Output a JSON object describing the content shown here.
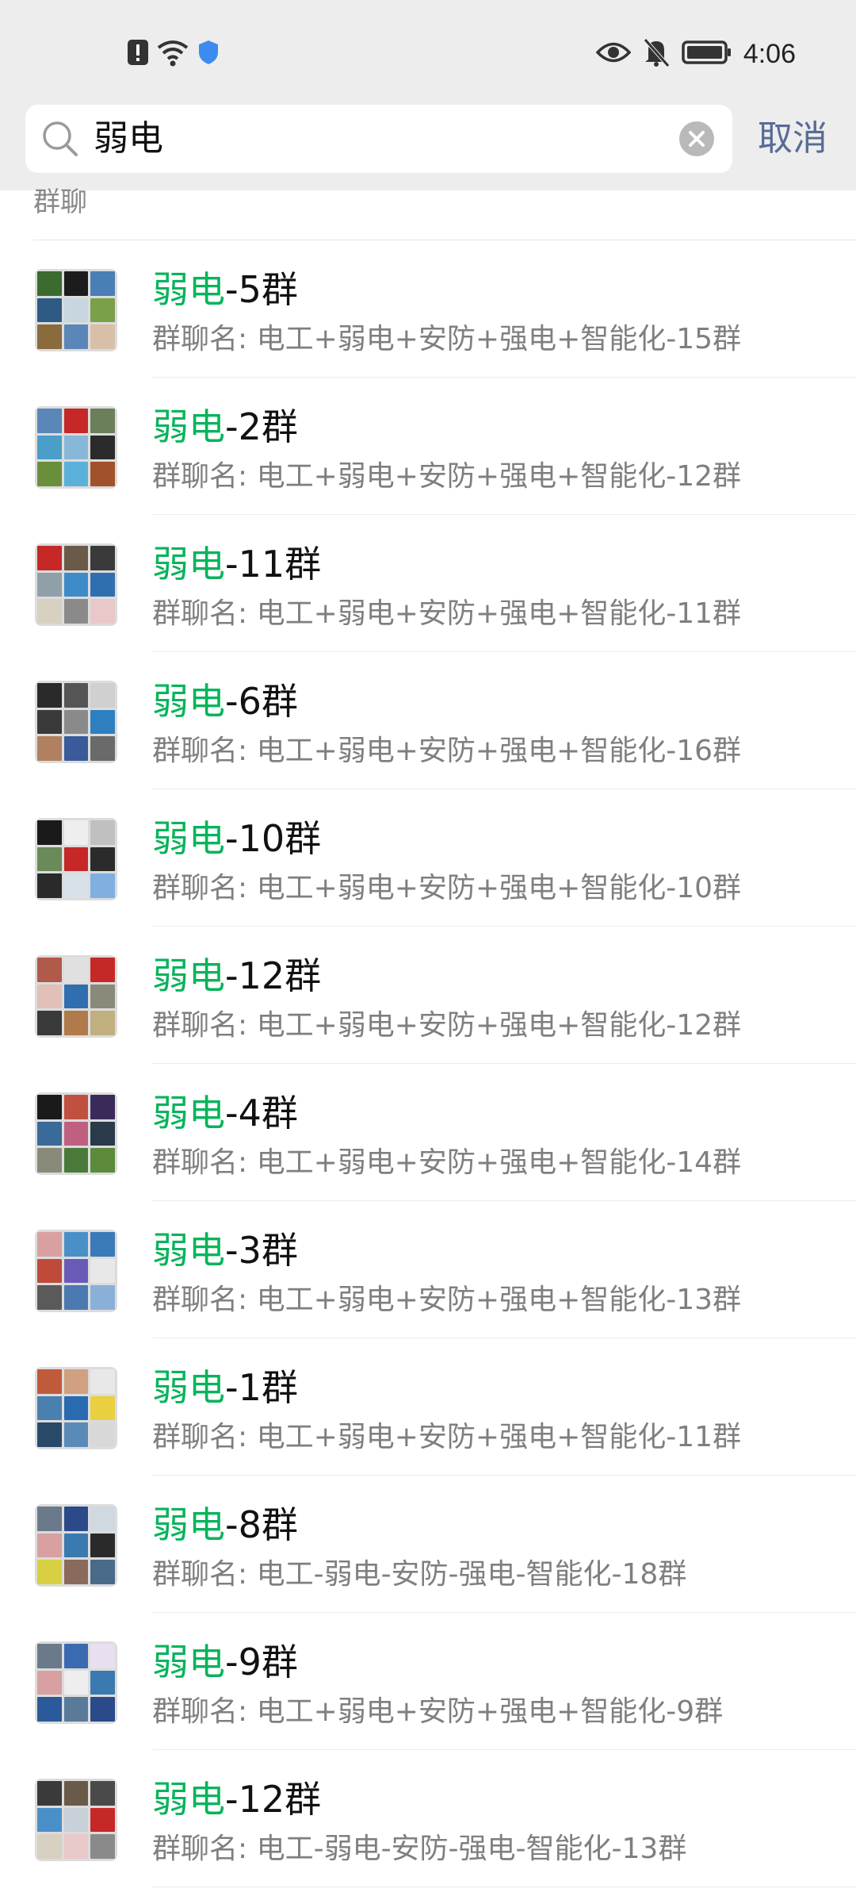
{
  "status_bar": {
    "time": "4:06",
    "left_icons": [
      "alert-icon",
      "wifi-icon",
      "shield-icon"
    ],
    "right_icons": [
      "eye-icon",
      "mute-icon",
      "battery-icon"
    ]
  },
  "search": {
    "query": "弱电",
    "cancel_label": "取消"
  },
  "section": {
    "label": "群聊"
  },
  "colors": {
    "keyword_highlight": "#07b45b",
    "cancel_link": "#576b95",
    "header_bg": "#ededed"
  },
  "results": [
    {
      "keyword": "弱电",
      "title_rest": "-5群",
      "subtitle": "群聊名: 电工+弱电+安防+强电+智能化-15群"
    },
    {
      "keyword": "弱电",
      "title_rest": "-2群",
      "subtitle": "群聊名: 电工+弱电+安防+强电+智能化-12群"
    },
    {
      "keyword": "弱电",
      "title_rest": "-11群",
      "subtitle": "群聊名: 电工+弱电+安防+强电+智能化-11群"
    },
    {
      "keyword": "弱电",
      "title_rest": "-6群",
      "subtitle": "群聊名: 电工+弱电+安防+强电+智能化-16群"
    },
    {
      "keyword": "弱电",
      "title_rest": "-10群",
      "subtitle": "群聊名: 电工+弱电+安防+强电+智能化-10群"
    },
    {
      "keyword": "弱电",
      "title_rest": "-12群",
      "subtitle": "群聊名: 电工+弱电+安防+强电+智能化-12群"
    },
    {
      "keyword": "弱电",
      "title_rest": "-4群",
      "subtitle": "群聊名: 电工+弱电+安防+强电+智能化-14群"
    },
    {
      "keyword": "弱电",
      "title_rest": "-3群",
      "subtitle": "群聊名: 电工+弱电+安防+强电+智能化-13群"
    },
    {
      "keyword": "弱电",
      "title_rest": "-1群",
      "subtitle": "群聊名: 电工+弱电+安防+强电+智能化-11群"
    },
    {
      "keyword": "弱电",
      "title_rest": "-8群",
      "subtitle": "群聊名: 电工-弱电-安防-强电-智能化-18群"
    },
    {
      "keyword": "弱电",
      "title_rest": "-9群",
      "subtitle": "群聊名: 电工+弱电+安防+强电+智能化-9群"
    },
    {
      "keyword": "弱电",
      "title_rest": "-12群",
      "subtitle": "群聊名: 电工-弱电-安防-强电-智能化-13群"
    }
  ]
}
